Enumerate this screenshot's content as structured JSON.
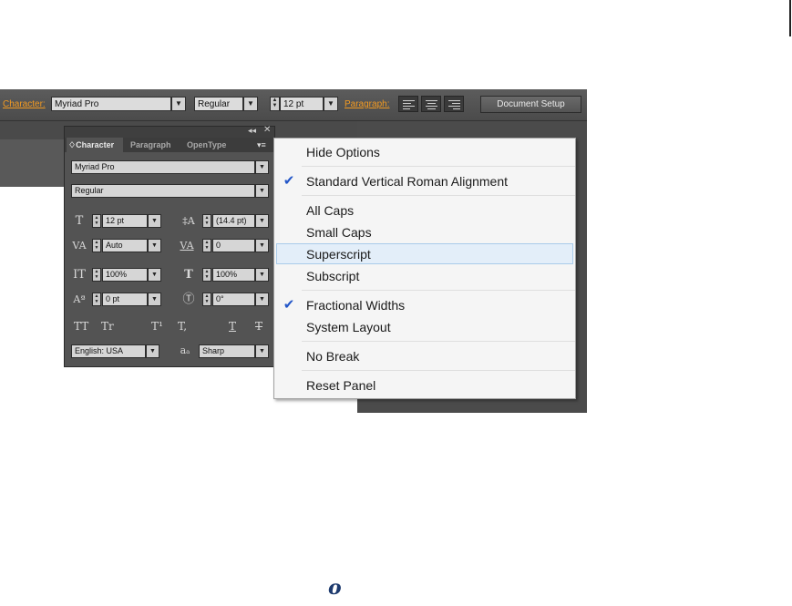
{
  "control_bar": {
    "character_label": "Character:",
    "font_family": "Myriad Pro",
    "font_style": "Regular",
    "font_size": "12 pt",
    "paragraph_label": "Paragraph:",
    "document_setup": "Document Setup"
  },
  "panel": {
    "tabs": [
      "Character",
      "Paragraph",
      "OpenType"
    ],
    "tab_prefix": "♢",
    "font_family": "Myriad Pro",
    "font_style": "Regular",
    "font_size": "12 pt",
    "leading": "(14.4 pt)",
    "kerning": "Auto",
    "tracking": "0",
    "vertical_scale": "100%",
    "horizontal_scale": "100%",
    "baseline_shift": "0 pt",
    "rotation": "0°",
    "style_buttons": [
      "TT",
      "Tr",
      "T¹",
      "T,",
      "T",
      "T"
    ],
    "language": "English: USA",
    "antialias_icon_text": "aₐ",
    "antialias": "Sharp"
  },
  "flyout_menu": {
    "items": [
      {
        "label": "Hide Options",
        "checked": false
      },
      {
        "label": "Standard Vertical Roman Alignment",
        "checked": true
      },
      {
        "label": "All Caps",
        "checked": false
      },
      {
        "label": "Small Caps",
        "checked": false
      },
      {
        "label": "Superscript",
        "checked": false,
        "highlighted": true
      },
      {
        "label": "Subscript",
        "checked": false
      },
      {
        "label": "Fractional Widths",
        "checked": true
      },
      {
        "label": "System Layout",
        "checked": false
      },
      {
        "label": "No Break",
        "checked": false
      },
      {
        "label": "Reset Panel",
        "checked": false
      }
    ],
    "check_glyph": "✔"
  },
  "bottom_glyph": "o",
  "colors": {
    "accent_orange": "#f29a22",
    "check_blue": "#2356c8",
    "highlight": "#e3eef9"
  }
}
